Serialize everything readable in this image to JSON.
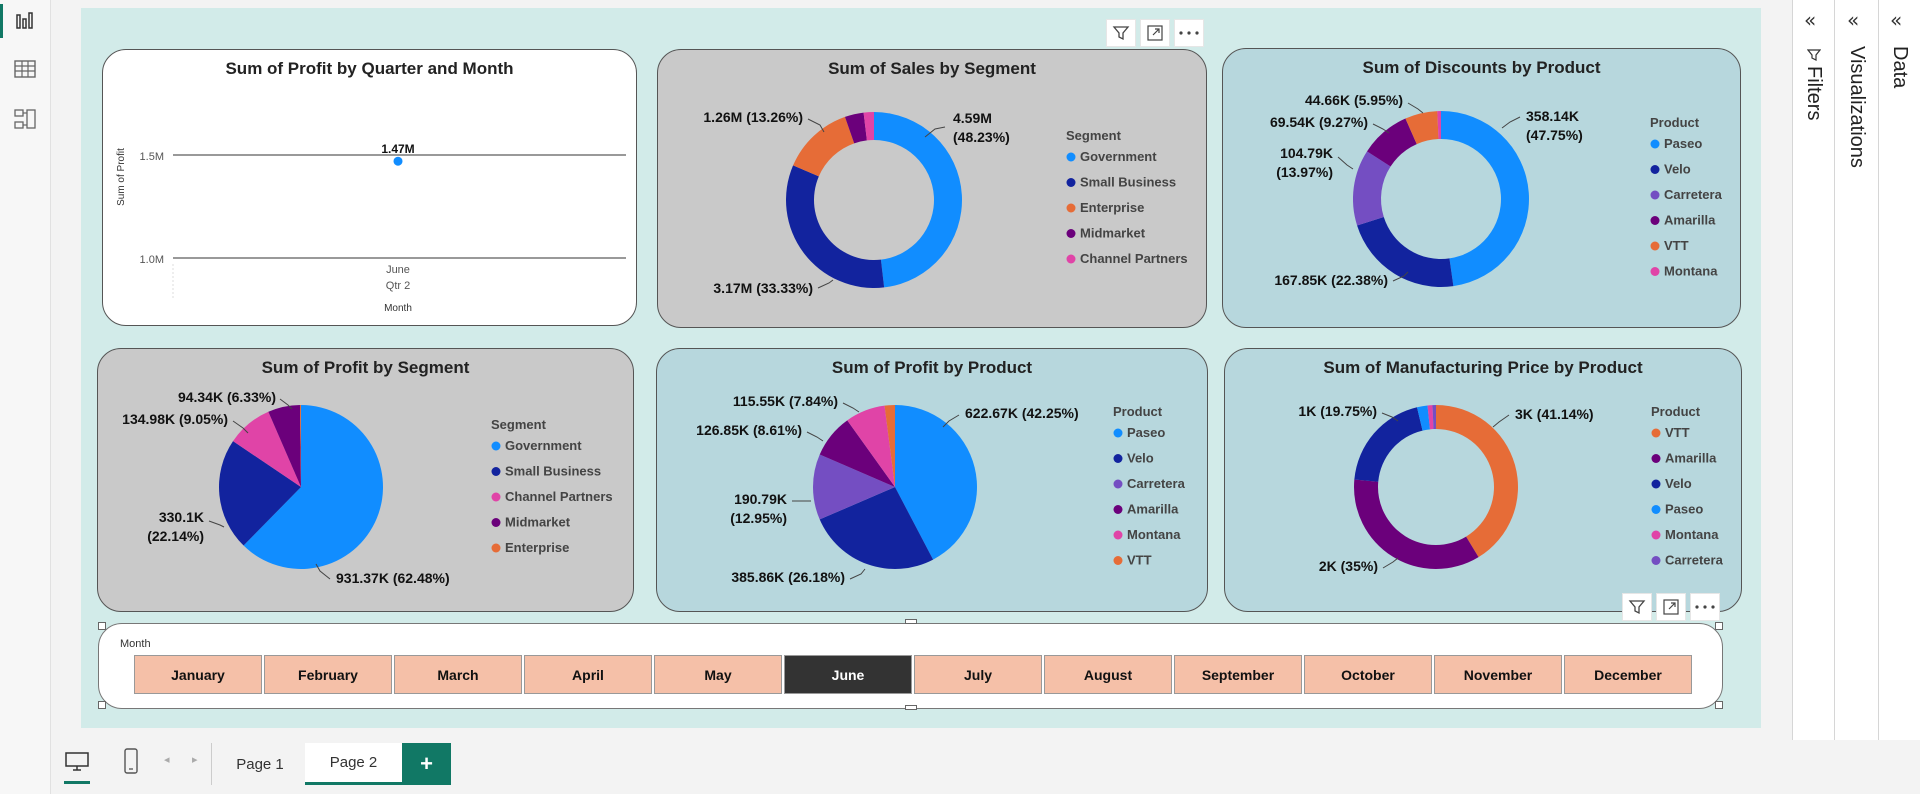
{
  "left_rail": {
    "icons": [
      "report-view-icon",
      "table-view-icon",
      "model-view-icon"
    ]
  },
  "visual_header": {
    "icons": [
      "filter-icon",
      "focus-mode-icon",
      "more-options-icon"
    ]
  },
  "visuals": {
    "profit_quarter_month": {
      "title": "Sum of Profit by Quarter and Month",
      "ylabel": "Sum of Profit",
      "xlabel": "Month",
      "tick_month": "June",
      "tick_quarter": "Qtr 2",
      "ytick_high": "1.5M",
      "ytick_low": "1.0M",
      "point_label": "1.47M"
    },
    "sales_segment": {
      "title": "Sum of Sales by Segment",
      "legend_title": "Segment"
    },
    "discounts_product": {
      "title": "Sum of Discounts by Product",
      "legend_title": "Product"
    },
    "profit_segment": {
      "title": "Sum of Profit by Segment",
      "legend_title": "Segment"
    },
    "profit_product": {
      "title": "Sum of Profit by Product",
      "legend_title": "Product"
    },
    "mfg_price_product": {
      "title": "Sum of Manufacturing Price by Product",
      "legend_title": "Product"
    }
  },
  "chart_data": [
    {
      "type": "line",
      "title": "Sum of Profit by Quarter and Month",
      "xlabel": "Month",
      "ylabel": "Sum of Profit",
      "x": [
        "June"
      ],
      "x_group": [
        "Qtr 2"
      ],
      "series": [
        {
          "values": [
            1470000
          ]
        }
      ],
      "data_labels": [
        "1.47M"
      ],
      "yticks": [
        "1.0M",
        "1.5M"
      ],
      "ylim": [
        900000,
        1550000
      ],
      "grid": true
    },
    {
      "type": "pie",
      "variant": "donut",
      "title": "Sum of Sales by Segment",
      "legend_title": "Segment",
      "legend_position": "right",
      "categories": [
        "Government",
        "Small Business",
        "Enterprise",
        "Midmarket",
        "Channel Partners"
      ],
      "values": [
        4590000,
        3170000,
        1260000,
        330000,
        180000
      ],
      "labels": [
        "4.59M\n(48.23%)",
        "3.17M (33.33%)",
        "1.26M (13.26%)",
        "",
        ""
      ],
      "colors": [
        "#118dff",
        "#12239e",
        "#e66c37",
        "#6b007b",
        "#e044a7"
      ]
    },
    {
      "type": "pie",
      "variant": "donut",
      "title": "Sum of Discounts by Product",
      "legend_title": "Product",
      "legend_position": "right",
      "categories": [
        "Paseo",
        "Velo",
        "Carretera",
        "Amarilla",
        "VTT",
        "Montana"
      ],
      "values": [
        358140,
        167850,
        104790,
        69540,
        44660,
        5000
      ],
      "labels": [
        "358.14K\n(47.75%)",
        "167.85K (22.38%)",
        "104.79K\n(13.97%)",
        "69.54K (9.27%)",
        "44.66K (5.95%)",
        ""
      ],
      "colors": [
        "#118dff",
        "#12239e",
        "#744ec2",
        "#6b007b",
        "#e66c37",
        "#e044a7"
      ]
    },
    {
      "type": "pie",
      "title": "Sum of Profit by Segment",
      "legend_title": "Segment",
      "legend_position": "right",
      "categories": [
        "Government",
        "Small Business",
        "Channel Partners",
        "Midmarket",
        "Enterprise"
      ],
      "values": [
        931370,
        330100,
        134980,
        94340,
        3000
      ],
      "labels": [
        "931.37K (62.48%)",
        "330.1K\n(22.14%)",
        "134.98K (9.05%)",
        "94.34K (6.33%)",
        ""
      ],
      "colors": [
        "#118dff",
        "#12239e",
        "#e044a7",
        "#6b007b",
        "#e66c37"
      ]
    },
    {
      "type": "pie",
      "title": "Sum of Profit by Product",
      "legend_title": "Product",
      "legend_position": "right",
      "categories": [
        "Paseo",
        "Velo",
        "Carretera",
        "Amarilla",
        "Montana",
        "VTT"
      ],
      "values": [
        622670,
        385860,
        190790,
        126850,
        115550,
        30000
      ],
      "labels": [
        "622.67K (42.25%)",
        "385.86K (26.18%)",
        "190.79K\n(12.95%)",
        "126.85K (8.61%)",
        "115.55K (7.84%)",
        ""
      ],
      "colors": [
        "#118dff",
        "#12239e",
        "#744ec2",
        "#6b007b",
        "#e044a7",
        "#e66c37"
      ]
    },
    {
      "type": "pie",
      "variant": "donut",
      "title": "Sum of Manufacturing Price by Product",
      "legend_title": "Product",
      "legend_position": "right",
      "categories": [
        "VTT",
        "Amarilla",
        "Velo",
        "Paseo",
        "Montana",
        "Carretera"
      ],
      "values": [
        3000,
        2550,
        1440,
        150,
        70,
        50
      ],
      "labels": [
        "3K (41.14%)",
        "2K (35%)",
        "1K (19.75%)",
        "",
        "",
        ""
      ],
      "colors": [
        "#e66c37",
        "#6b007b",
        "#12239e",
        "#118dff",
        "#e044a7",
        "#744ec2"
      ]
    }
  ],
  "slicer": {
    "title": "Month",
    "months": [
      "January",
      "February",
      "March",
      "April",
      "May",
      "June",
      "July",
      "August",
      "September",
      "October",
      "November",
      "December"
    ],
    "selected": "June"
  },
  "right_panes": {
    "filters_label": "Filters",
    "visualizations_label": "Visualizations",
    "data_label": "Data",
    "collapse_glyph": "«"
  },
  "tabs": {
    "page1": "Page 1",
    "page2": "Page 2",
    "add": "+"
  }
}
